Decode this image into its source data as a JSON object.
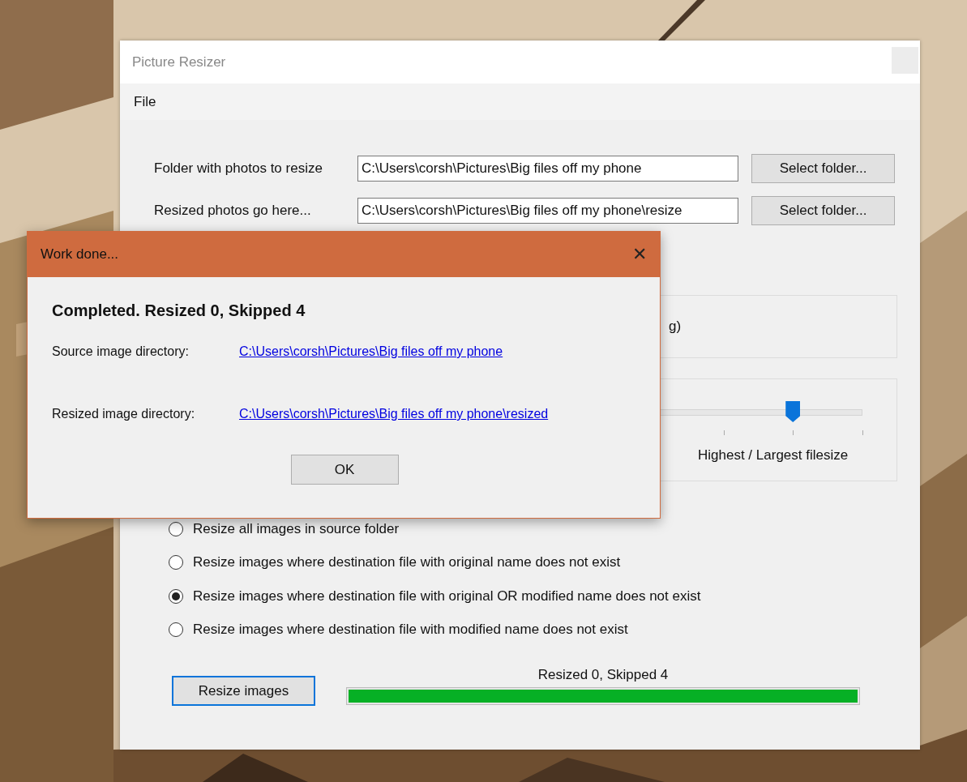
{
  "window": {
    "title": "Picture Resizer"
  },
  "menu": [
    "File"
  ],
  "folder_rows": [
    {
      "label": "Folder with photos to resize",
      "value": "C:\\Users\\corsh\\Pictures\\Big files off my phone",
      "button": "Select folder..."
    },
    {
      "label": "Resized photos go here...",
      "value": "C:\\Users\\corsh\\Pictures\\Big files off my phone\\resize",
      "button": "Select folder..."
    }
  ],
  "format_group": {
    "text": "g)"
  },
  "quality": {
    "level": 0.75,
    "label": "Highest / Largest filesize"
  },
  "options": [
    {
      "label": "Resize all images in source folder",
      "selected": false
    },
    {
      "label": "Resize images where destination file with original name does not exist",
      "selected": false
    },
    {
      "label": "Resize images where destination file with original OR modified name does not exist",
      "selected": true
    },
    {
      "label": "Resize images where destination file with modified name does not exist",
      "selected": false
    }
  ],
  "resize_button": "Resize images",
  "progress": {
    "label": "Resized 0, Skipped 4",
    "level": 1
  },
  "dialog": {
    "title": "Work done...",
    "close": "✕",
    "heading": "Completed. Resized 0, Skipped 4",
    "rows": [
      {
        "label": "Source image directory:",
        "link": "C:\\Users\\corsh\\Pictures\\Big files off my phone"
      },
      {
        "label": "Resized image directory:",
        "link": "C:\\Users\\corsh\\Pictures\\Big files off my phone\\resized"
      }
    ],
    "ok_button": "OK"
  }
}
